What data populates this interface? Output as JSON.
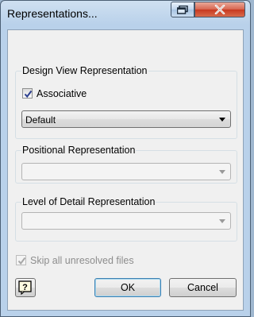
{
  "window": {
    "title": "Representations..."
  },
  "design_view": {
    "label": "Design View Representation",
    "associative_label": "Associative",
    "associative_checked": true,
    "selected": "Default"
  },
  "positional": {
    "label": "Positional Representation",
    "selected": ""
  },
  "level_of_detail": {
    "label": "Level of Detail Representation",
    "selected": ""
  },
  "skip_unresolved": {
    "label": "Skip all unresolved files",
    "checked": true,
    "enabled": false
  },
  "buttons": {
    "ok": "OK",
    "cancel": "Cancel"
  },
  "icons": {
    "help": "help-question-icon",
    "restore": "restore-icon",
    "close": "close-icon"
  }
}
